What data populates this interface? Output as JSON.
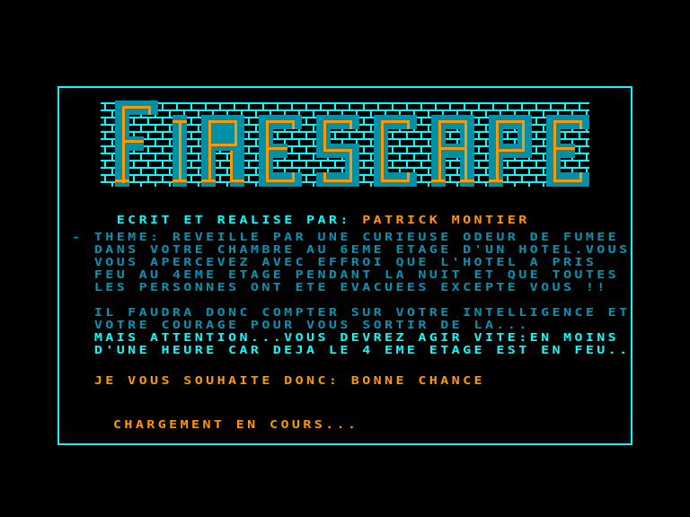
{
  "game": {
    "title": "FIRESCAPE",
    "colors": {
      "background": "#000000",
      "border": "#00FFFF",
      "brick_mortar": "#00FFFF",
      "letter_fill": "#0090A8",
      "letter_stroke": "#FF9800",
      "text_cyan": "#00FFFF",
      "text_teal": "#0095B5",
      "text_orange": "#FF9800"
    }
  },
  "credits": {
    "label": "ECRIT ET REALISE PAR:",
    "author": "PATRICK MONTIER"
  },
  "story": {
    "paragraph1": [
      "- THEME: REVEILLE PAR UNE CURIEUSE ODEUR DE FUMEE",
      "  DANS VOTRE CHAMBRE AU 6EME ETAGE D'UN HOTEL.VOUS",
      "  VOUS APERCEVEZ AVEC EFFROI QUE L'HOTEL A PRIS",
      "  FEU AU 4EME ETAGE PENDANT LA NUIT ET QUE TOUTES",
      "  LES PERSONNES ONT ETE EVACUEES EXCEPTE VOUS !!"
    ],
    "paragraph2": [
      "  IL FAUDRA DONC COMPTER SUR VOTRE INTELLIGENCE ET",
      "  VOTRE COURAGE POUR VOUS SORTIR DE LA..."
    ],
    "warning": [
      "  MAIS ATTENTION...VOUS DEVREZ AGIR VITE:EN MOINS",
      "  D'UNE HEURE CAR DEJA LE 4 EME ETAGE EST EN FEU.."
    ],
    "wish": "  JE VOUS SOUHAITE DONC: BONNE CHANCE"
  },
  "status": {
    "loading": "CHARGEMENT EN COURS..."
  }
}
